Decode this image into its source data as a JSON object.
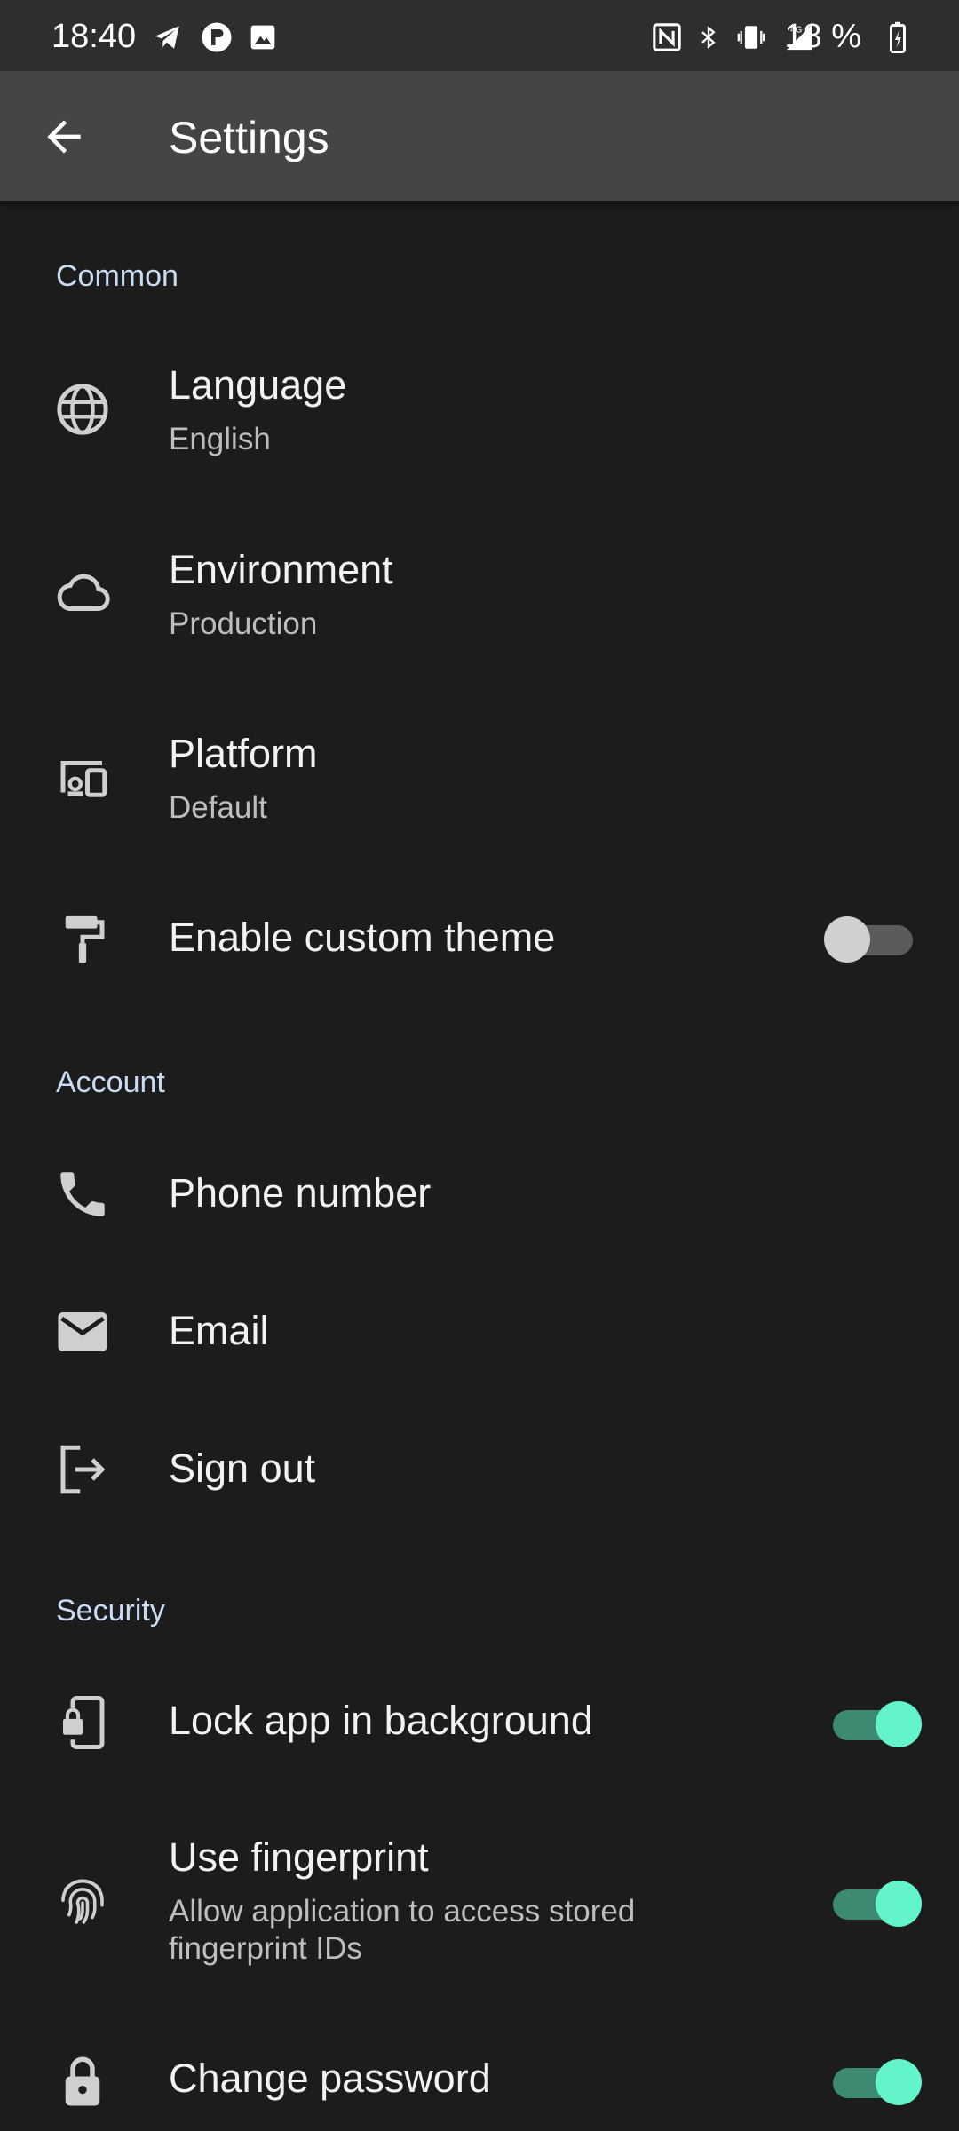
{
  "status_bar": {
    "time": "18:40",
    "battery": "18 %",
    "icons": [
      "telegram-icon",
      "app-icon",
      "image-icon",
      "nfc-icon",
      "bluetooth-icon",
      "vibrate-icon",
      "signal-4g-icon",
      "battery-charging-icon"
    ]
  },
  "app_bar": {
    "title": "Settings",
    "back_icon": "arrow-back-icon"
  },
  "sections": {
    "common": "Common",
    "account": "Account",
    "security": "Security"
  },
  "items": {
    "language": {
      "label": "Language",
      "value": "English",
      "icon": "globe-icon"
    },
    "environment": {
      "label": "Environment",
      "value": "Production",
      "icon": "cloud-icon"
    },
    "platform": {
      "label": "Platform",
      "value": "Default",
      "icon": "devices-icon"
    },
    "custom_theme": {
      "label": "Enable custom theme",
      "icon": "paint-roller-icon",
      "enabled": false
    },
    "phone": {
      "label": "Phone number",
      "icon": "phone-icon"
    },
    "email": {
      "label": "Email",
      "icon": "mail-icon"
    },
    "sign_out": {
      "label": "Sign out",
      "icon": "logout-icon"
    },
    "lock_app": {
      "label": "Lock app in background",
      "icon": "phone-lock-icon",
      "enabled": true
    },
    "fingerprint": {
      "label": "Use fingerprint",
      "description": "Allow application to access stored fingerprint IDs",
      "icon": "fingerprint-icon",
      "enabled": true
    },
    "change_password": {
      "label": "Change password",
      "icon": "lock-icon",
      "enabled": true
    }
  },
  "colors": {
    "background": "#1c1c1c",
    "app_bar": "#454545",
    "section_header": "#c9dcf6",
    "toggle_on_thumb": "#63f4cb",
    "toggle_on_track": "#3d8a73",
    "toggle_off_thumb": "#d0d0d0"
  }
}
